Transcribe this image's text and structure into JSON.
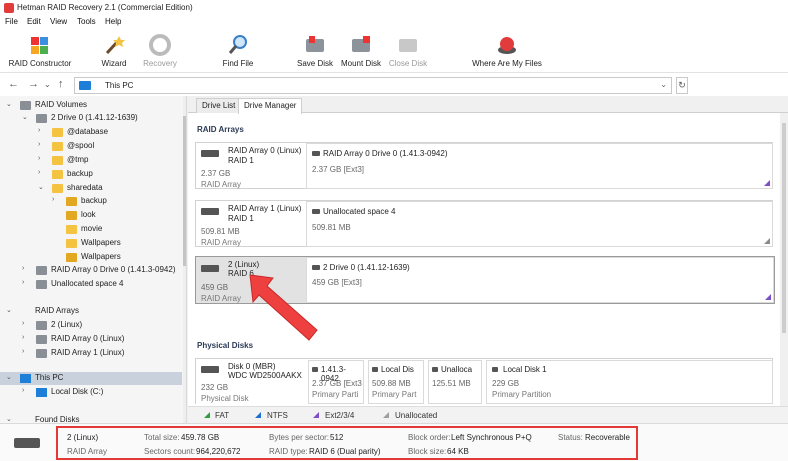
{
  "window": {
    "title": "Hetman RAID Recovery 2.1 (Commercial Edition)"
  },
  "menu": [
    "File",
    "Edit",
    "View",
    "Tools",
    "Help"
  ],
  "toolbar": {
    "raid_constructor": "RAID Constructor",
    "wizard": "Wizard",
    "recovery": "Recovery",
    "find_file": "Find File",
    "save_disk": "Save Disk",
    "mount_disk": "Mount Disk",
    "close_disk": "Close Disk",
    "where_are_my_files": "Where Are My Files"
  },
  "address": {
    "path": "This PC"
  },
  "tree": {
    "raid_volumes": "RAID Volumes",
    "drive0": "2 Drive 0 (1.41.12-1639)",
    "folders": [
      "@database",
      "@spool",
      "@tmp",
      "backup",
      "sharedata"
    ],
    "sharedata_children": [
      "backup",
      "look",
      "movie",
      "Wallpapers",
      "Wallpapers"
    ],
    "raid_array0_drive0": "RAID Array 0 Drive 0 (1.41.3-0942)",
    "unallocated4": "Unallocated space 4",
    "raid_arrays": "RAID Arrays",
    "arrays": [
      "2 (Linux)",
      "RAID Array 0 (Linux)",
      "RAID Array 1 (Linux)"
    ],
    "this_pc": "This PC",
    "local_disk": "Local Disk (C:)",
    "found_disks": "Found Disks"
  },
  "tabs": {
    "drive_list": "Drive List",
    "drive_manager": "Drive Manager"
  },
  "raid_section": "RAID Arrays",
  "raid_cards": [
    {
      "name": "RAID Array 0 (Linux)",
      "level": "RAID 1",
      "size": "2.37 GB",
      "type": "RAID Array",
      "vol_name": "RAID Array 0 Drive 0 (1.41.3-0942)",
      "vol_size": "2.37 GB [Ext3]"
    },
    {
      "name": "RAID Array 1 (Linux)",
      "level": "RAID 1",
      "size": "509.81 MB",
      "type": "RAID Array",
      "vol_name": "Unallocated space 4",
      "vol_size": "509.81 MB"
    },
    {
      "name": "2 (Linux)",
      "level": "RAID 6",
      "size": "459 GB",
      "type": "RAID Array",
      "vol_name": "2 Drive 0 (1.41.12-1639)",
      "vol_size": "459 GB [Ext3]"
    }
  ],
  "physical_section": "Physical Disks",
  "physical_disk": {
    "name": "Disk 0 (MBR)",
    "model": "WDC WD2500AAKX",
    "size": "232 GB",
    "type": "Physical Disk",
    "parts": [
      {
        "name": "1.41.3-0942",
        "size": "2.37 GB [Ext3",
        "type": "Primary Parti"
      },
      {
        "name": "Local Dis",
        "size": "509.88 MB",
        "type": "Primary Part"
      },
      {
        "name": "Unalloca",
        "size": "125.51 MB",
        "type": ""
      },
      {
        "name": "Local Disk 1",
        "size": "229 GB",
        "type": "Primary Partition"
      }
    ]
  },
  "legend": [
    {
      "label": "FAT",
      "color": "#2e9e3e"
    },
    {
      "label": "NTFS",
      "color": "#1e6fd0"
    },
    {
      "label": "Ext2/3/4",
      "color": "#7a4fc8"
    },
    {
      "label": "Unallocated",
      "color": "#9e9e9e"
    }
  ],
  "status": {
    "name": "2 (Linux)",
    "type": "RAID Array",
    "total_size_k": "Total size:",
    "total_size_v": "459.78 GB",
    "sectors_k": "Sectors count:",
    "sectors_v": "964,220,672",
    "bps_k": "Bytes per sector:",
    "bps_v": "512",
    "raidtype_k": "RAID type:",
    "raidtype_v": "RAID 6 (Dual parity)",
    "blockorder_k": "Block order:",
    "blockorder_v": "Left Synchronous P+Q",
    "blocksize_k": "Block size:",
    "blocksize_v": "64 KB",
    "status_k": "Status:",
    "status_v": "Recoverable"
  },
  "colors": {
    "accent": "#e53935",
    "ext": "#7a4fc8",
    "selection": "#c9d2dc"
  }
}
